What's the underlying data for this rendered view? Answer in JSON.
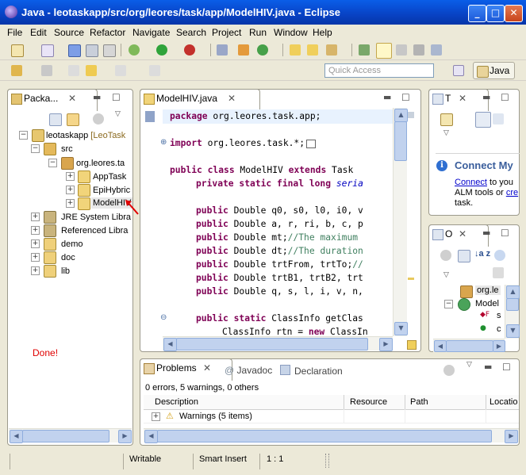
{
  "window": {
    "title": "Java - leotaskapp/src/org/leores/task/app/ModelHIV.java - Eclipse",
    "min": "_",
    "max": "□",
    "close": "✕"
  },
  "menu": [
    "File",
    "Edit",
    "Source",
    "Refactor",
    "Navigate",
    "Search",
    "Project",
    "Run",
    "Window",
    "Help"
  ],
  "toolbar": {
    "quick_access_placeholder": "Quick Access",
    "perspective_label": "Java"
  },
  "package_explorer": {
    "tab_label": "Packa...",
    "items": [
      {
        "label": "leotaskapp",
        "decoration": "[LeoTask"
      },
      {
        "label": "src"
      },
      {
        "label": "org.leores.ta"
      },
      {
        "label": "AppTask"
      },
      {
        "label": "EpiHybric"
      },
      {
        "label": "ModelHIV"
      },
      {
        "label": "JRE System Libra"
      },
      {
        "label": "Referenced Libra"
      },
      {
        "label": "demo"
      },
      {
        "label": "doc"
      },
      {
        "label": "lib"
      }
    ],
    "annotation": "Done!"
  },
  "editor": {
    "tab_label": "ModelHIV.java",
    "lines": [
      {
        "t": "package",
        "r": " org.leores.task.app;"
      },
      {
        "t": "import",
        "r": " org.leores.task.*;"
      },
      {
        "t": "public class",
        "r": " ModelHIV ",
        "k2": "extends",
        "r2": " Task"
      },
      {
        "t": "private static final long",
        "r": " ",
        "it": "seria"
      },
      {
        "t": "public",
        "r": " Double q0, s0, l0, i0, v"
      },
      {
        "t": "public",
        "r": " Double a, r, ri, b, c, p"
      },
      {
        "t": "public",
        "r": " Double mt;",
        "c": "//The maximum"
      },
      {
        "t": "public",
        "r": " Double dt;",
        "c": "//The duration"
      },
      {
        "t": "public",
        "r": " Double trtFrom, trtTo;",
        "c": "//"
      },
      {
        "t": "public",
        "r": " Double trtB1, trtB2, trt"
      },
      {
        "t": "public",
        "r": " Double q, s, l, i, v, n,"
      },
      {
        "t": "public static",
        "r": " ClassInfo getClas"
      },
      {
        "t": "",
        "r": "ClassInfo rtn = ",
        "k2": "new",
        "r2": " ClassIn"
      }
    ]
  },
  "task_list": {
    "tab_label": "T",
    "connect_title": "Connect My",
    "connect_link": "Connect",
    "connect_text1": " to you",
    "connect_text2": "ALM tools or ",
    "connect_link2": "cre",
    "connect_text3": "task."
  },
  "outline": {
    "tab_label": "O",
    "items": [
      {
        "label": "org.le"
      },
      {
        "label": "Model"
      },
      {
        "label": "s"
      },
      {
        "label": "c"
      }
    ]
  },
  "problems": {
    "tabs": [
      "Problems",
      "Javadoc",
      "Declaration"
    ],
    "summary": "0 errors, 5 warnings, 0 others",
    "columns": [
      "Description",
      "Resource",
      "Path",
      "Locatio"
    ],
    "rows": [
      {
        "label": "Warnings (5 items)"
      }
    ]
  },
  "status": {
    "writable": "Writable",
    "insert": "Smart Insert",
    "position": "1 : 1"
  },
  "colors": {
    "keyword": "#7f0055",
    "comment": "#3f7f5f",
    "field": "#0000c0",
    "titlebar": "#0842c4"
  }
}
